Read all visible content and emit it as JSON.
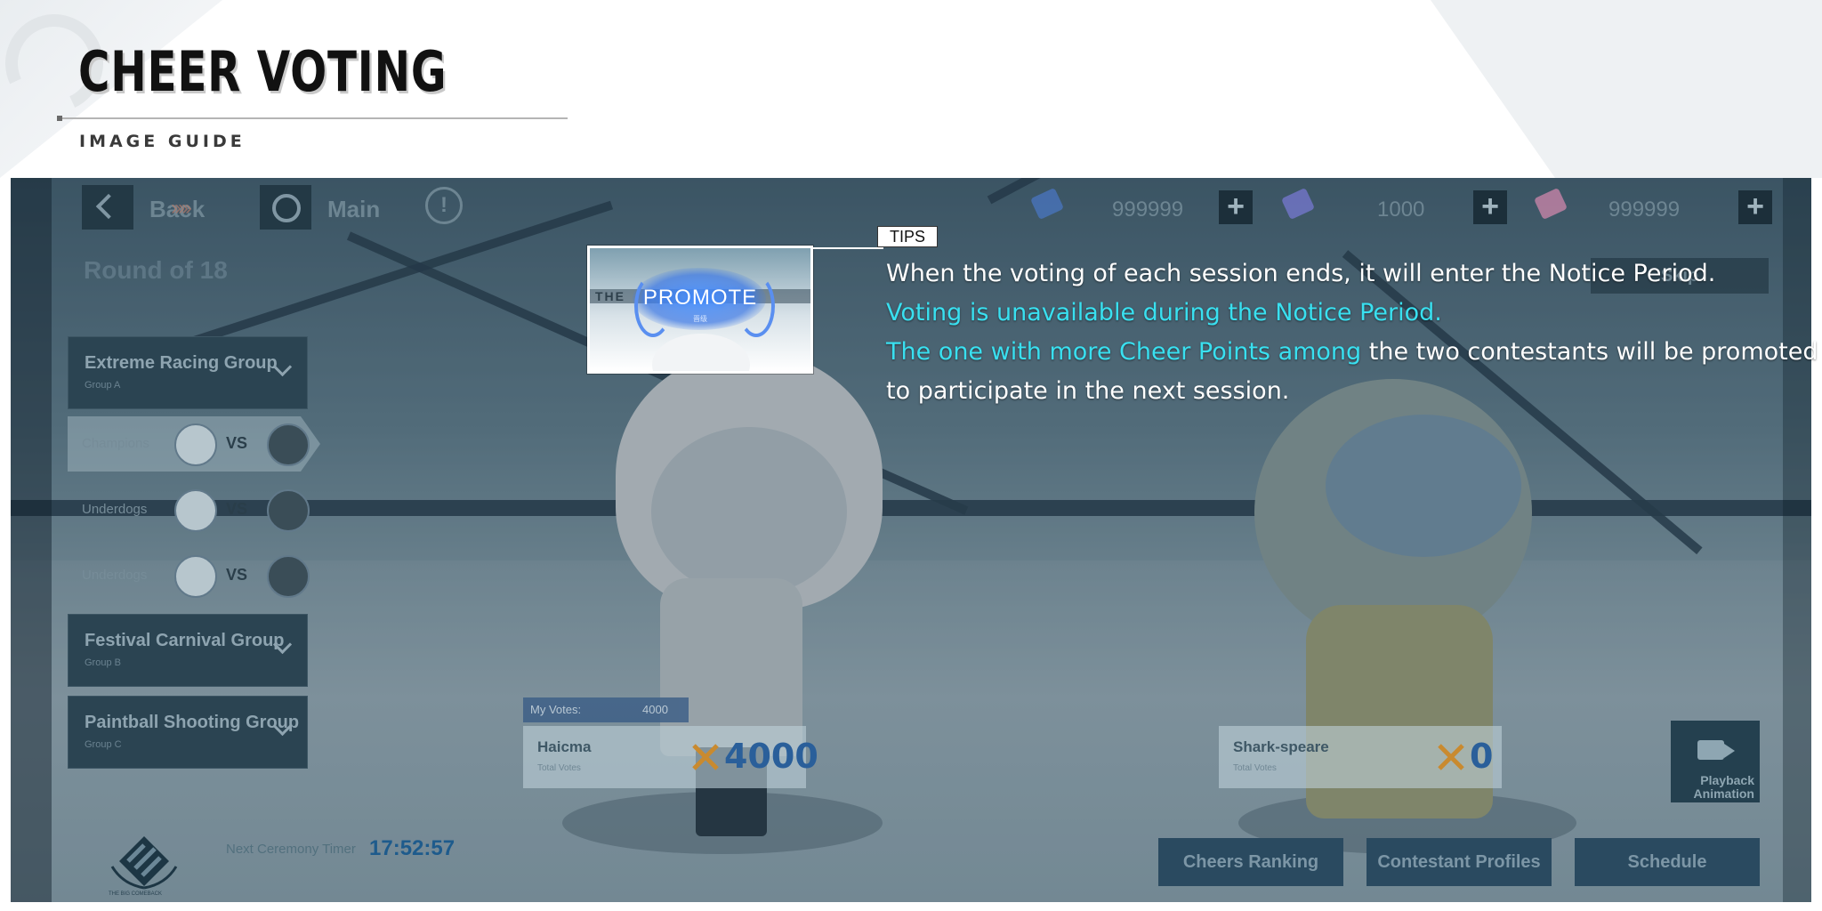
{
  "header": {
    "title": "CHEER VOTING",
    "subtitle": "IMAGE GUIDE"
  },
  "game": {
    "topbar": {
      "back_label": "Back",
      "main_label": "Main",
      "currencies": [
        {
          "amount": "999999",
          "icon": "ticket-blue-icon",
          "color": "#4a78c8"
        },
        {
          "amount": "1000",
          "icon": "ticket-purple-icon",
          "color": "#7b7bd8"
        },
        {
          "amount": "999999",
          "icon": "ticket-pink-icon",
          "color": "#d88ab0"
        }
      ],
      "plus_label": "+"
    },
    "round_label": "Round of 18",
    "skip_label": "Skip",
    "stage_sign": "THE",
    "groups": [
      {
        "name": "Extreme Racing Group",
        "sub": "Group A"
      },
      {
        "name": "Festival Carnival Group",
        "sub": "Group B"
      },
      {
        "name": "Paintball Shooting Group",
        "sub": "Group C"
      }
    ],
    "matches": [
      {
        "label": "Champions",
        "vs": "VS"
      },
      {
        "label": "Underdogs",
        "vs": "VS"
      },
      {
        "label": "Underdogs",
        "vs": "VS"
      }
    ],
    "left_contestant": {
      "name": "Haicma",
      "sub": "Total Votes",
      "votes": "4000",
      "my_votes_label": "My Votes:",
      "my_votes_value": "4000"
    },
    "right_contestant": {
      "name": "Shark-speare",
      "sub": "Total Votes",
      "votes": "0"
    },
    "playback_label": "Playback Animation",
    "logo_caption": "THE BIG COMEBACK",
    "timer_label": "Next Ceremony Timer",
    "timer_value": "17:52:57",
    "bottom_buttons": [
      "Cheers Ranking",
      "Contestant Profiles",
      "Schedule"
    ]
  },
  "tips": {
    "badge": "TIPS",
    "thumb_promote": "PROMOTE",
    "thumb_promote_sub": "晋级",
    "line1": "When the voting of each session ends, it will enter the Notice Period.",
    "line2": "Voting is unavailable during the Notice Period.",
    "line3_highlight": "The one with more Cheer Points among",
    "line3_rest": " the two contestants will be promoted",
    "line4": "to participate in the next session.",
    "highlight_color": "#39e0f0"
  }
}
